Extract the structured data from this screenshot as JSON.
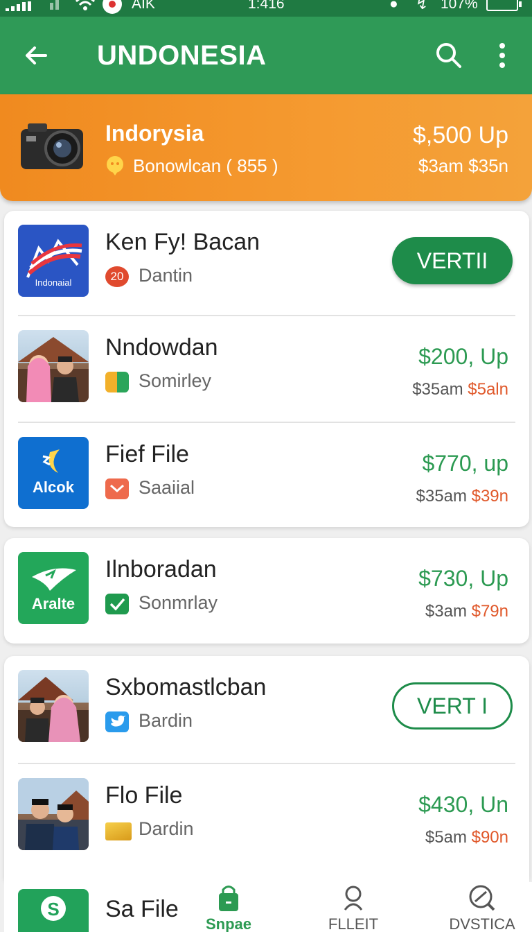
{
  "status": {
    "carrier": "AIK",
    "time": "1:416",
    "battery": "107%"
  },
  "header": {
    "title": "UNDONESIA"
  },
  "banner": {
    "name": "Indorysia",
    "subtitle": "Bonowlcan ( 855 )",
    "price": "$,500 Up",
    "schedule": "$3am $35n"
  },
  "list": {
    "items": [
      {
        "title": "Ken Fy! Bacan",
        "tag": "20",
        "subtitle": "Dantin",
        "button": "VERTII",
        "thumb_label": "Indonaial"
      },
      {
        "title": "Nndowdan",
        "subtitle": "Somirley",
        "price": "$200, Up",
        "sched_a": "$35am ",
        "sched_b": "$5aln"
      },
      {
        "title": "Fief File",
        "subtitle": "Saaiial",
        "price": "$770, up",
        "sched_a": "$35am ",
        "sched_b": "$39n",
        "thumb_label": "Alcok"
      },
      {
        "title": "Ilnboradan",
        "subtitle": "Sonmrlay",
        "price": "$730, Up",
        "sched_a": "$3am ",
        "sched_b": "$79n",
        "thumb_label": "Aralte"
      },
      {
        "title": "Sxbomastlcban",
        "subtitle": "Bardin",
        "button": "VERT I"
      },
      {
        "title": "Flo File",
        "subtitle": "Dardin",
        "price": "$430, Un",
        "sched_a": "$5am ",
        "sched_b": "$90n"
      },
      {
        "title": "Sa File"
      }
    ]
  },
  "nav": {
    "items": [
      {
        "label": "Snpae"
      },
      {
        "label": "FLLEIT"
      },
      {
        "label": "DVSTICA"
      }
    ]
  },
  "colors": {
    "primary": "#2f9a57",
    "accent": "#f08a1f",
    "price_green": "#2c9a52",
    "highlight": "#e0582a"
  }
}
